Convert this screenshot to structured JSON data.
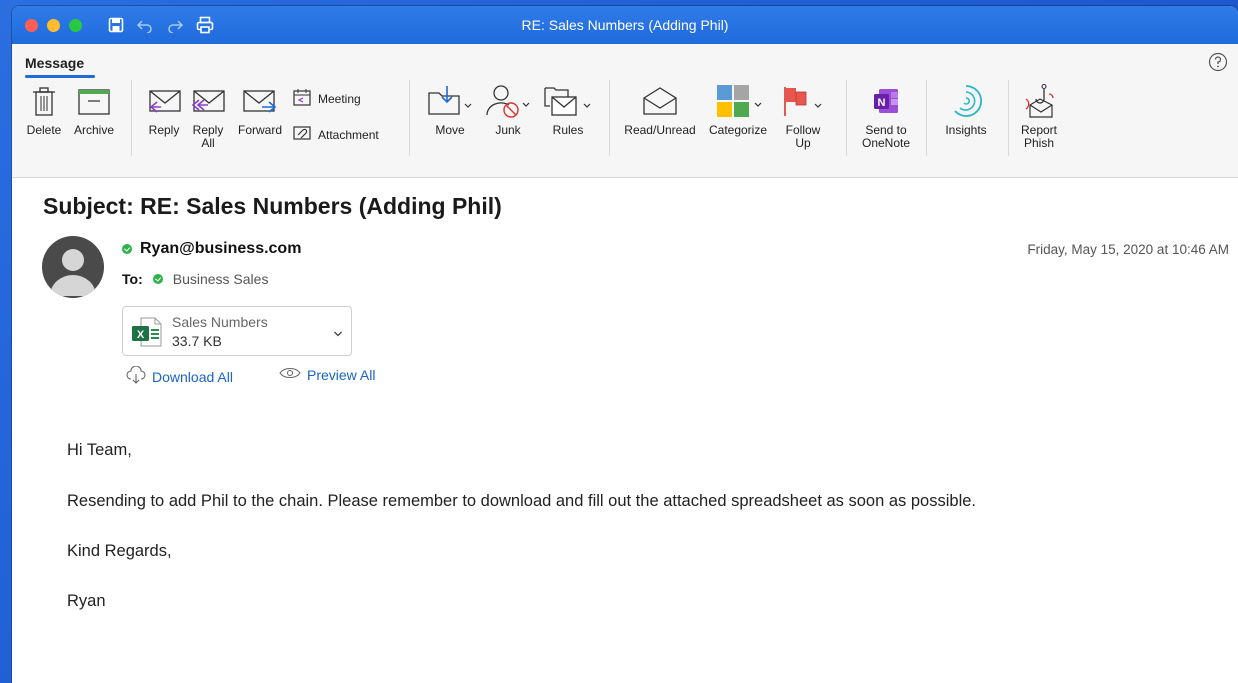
{
  "window": {
    "title": "RE: Sales Numbers (Adding Phil)"
  },
  "ribbon": {
    "tab": "Message",
    "buttons": {
      "delete": "Delete",
      "archive": "Archive",
      "reply": "Reply",
      "reply_all_1": "Reply",
      "reply_all_2": "All",
      "forward": "Forward",
      "meeting": "Meeting",
      "attachment": "Attachment",
      "move": "Move",
      "junk": "Junk",
      "rules": "Rules",
      "read_unread": "Read/Unread",
      "categorize": "Categorize",
      "follow_up_1": "Follow",
      "follow_up_2": "Up",
      "send_onenote_1": "Send to",
      "send_onenote_2": "OneNote",
      "insights": "Insights",
      "report_phish_1": "Report",
      "report_phish_2": "Phish"
    }
  },
  "message": {
    "subject": "Subject: RE: Sales Numbers (Adding Phil)",
    "sender": "Ryan@business.com",
    "to_label": "To:",
    "to": "Business Sales",
    "date": "Friday, May 15, 2020 at 10:46 AM",
    "attachment": {
      "name": "Sales Numbers",
      "size": "33.7 KB"
    },
    "download_all": "Download All",
    "preview_all": "Preview All",
    "body": [
      "Hi Team,",
      "Resending to add Phil to the chain. Please remember to download and fill out the attached spreadsheet as soon as possible.",
      "Kind Regards,",
      "Ryan"
    ]
  },
  "colors": {
    "accent": "#1f6bdc",
    "link": "#1a63c9",
    "presence": "#2db24a"
  }
}
